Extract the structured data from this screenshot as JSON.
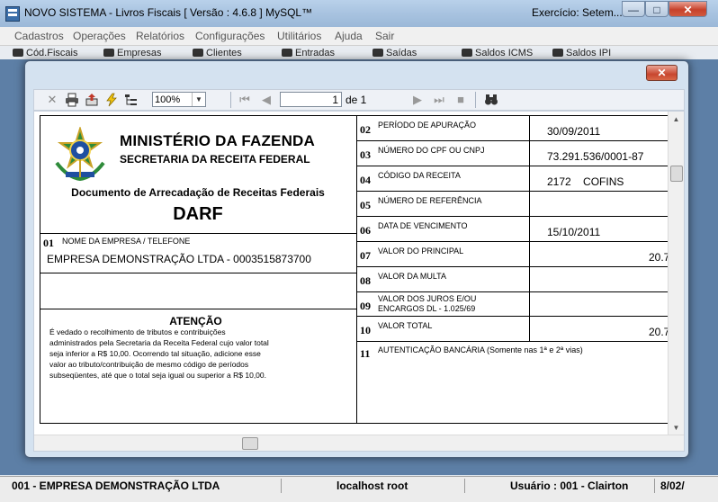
{
  "app": {
    "title": "NOVO SISTEMA - Livros Fiscais  [ Versão : 4.6.8 ]  MySQL™",
    "exercise": "Exercício: Setem...",
    "window_buttons": {
      "minimize": "—",
      "maximize": "□",
      "close": "✕"
    }
  },
  "menu": [
    "Cadastros",
    "Operações",
    "Relatórios",
    "Configurações",
    "Utilitários",
    "Ajuda",
    "Sair"
  ],
  "toolbar": [
    "Cód.Fiscais",
    "Empresas",
    "Clientes",
    "Entradas",
    "Saídas",
    "Saldos ICMS",
    "Saldos IPI"
  ],
  "statusbar": {
    "company": "001 - EMPRESA DEMONSTRAÇÃO LTDA",
    "server": "localhost  root",
    "user": "Usuário : 001 - Clairton",
    "date": "8/02/"
  },
  "dialog": {
    "close_label": "✕",
    "report_toolbar": {
      "zoom": "100%",
      "page": "1",
      "page_total": "de 1"
    }
  },
  "darf": {
    "ministry": "MINISTÉRIO DA FAZENDA",
    "secretariat": "SECRETARIA DA RECEITA FEDERAL",
    "document_title": "Documento de Arrecadação de Receitas Federais",
    "form_name": "DARF",
    "field01": {
      "num": "01",
      "label": "NOME DA EMPRESA / TELEFONE",
      "value": "EMPRESA DEMONSTRAÇÃO LTDA - 0003515873700"
    },
    "attention": {
      "title": "ATENÇÃO",
      "lines": [
        "É vedado o recolhimento de tributos e contribuições",
        "administrados pela Secretaria da Receita Federal cujo valor total",
        "seja inferior a R$ 10,00. Ocorrendo tal situação, adicione esse",
        "valor ao tributo/contribuição de mesmo código de períodos",
        "subseqüentes, até que o total seja igual ou superior a R$ 10,00."
      ]
    },
    "fields": [
      {
        "num": "02",
        "label": "PERÍODO DE APURAÇÃO",
        "value": "30/09/2011"
      },
      {
        "num": "03",
        "label": "NÚMERO DO CPF OU CNPJ",
        "value": "73.291.536/0001-87"
      },
      {
        "num": "04",
        "label": "CÓDIGO DA RECEITA",
        "value": "2172    COFINS"
      },
      {
        "num": "05",
        "label": "NÚMERO DE REFERÊNCIA",
        "value": ""
      },
      {
        "num": "06",
        "label": "DATA DE VENCIMENTO",
        "value": "15/10/2011"
      },
      {
        "num": "07",
        "label": "VALOR DO PRINCIPAL",
        "value": "20.7"
      },
      {
        "num": "08",
        "label": "VALOR DA MULTA",
        "value": ""
      },
      {
        "num": "09",
        "label": "VALOR DOS JUROS E/OU",
        "label2": "ENCARGOS DL - 1.025/69",
        "value": ""
      },
      {
        "num": "10",
        "label": "VALOR TOTAL",
        "value": "20.7"
      },
      {
        "num": "11",
        "label": "AUTENTICAÇÃO BANCÁRIA (Somente nas 1ª e 2ª vias)",
        "value": ""
      }
    ]
  }
}
